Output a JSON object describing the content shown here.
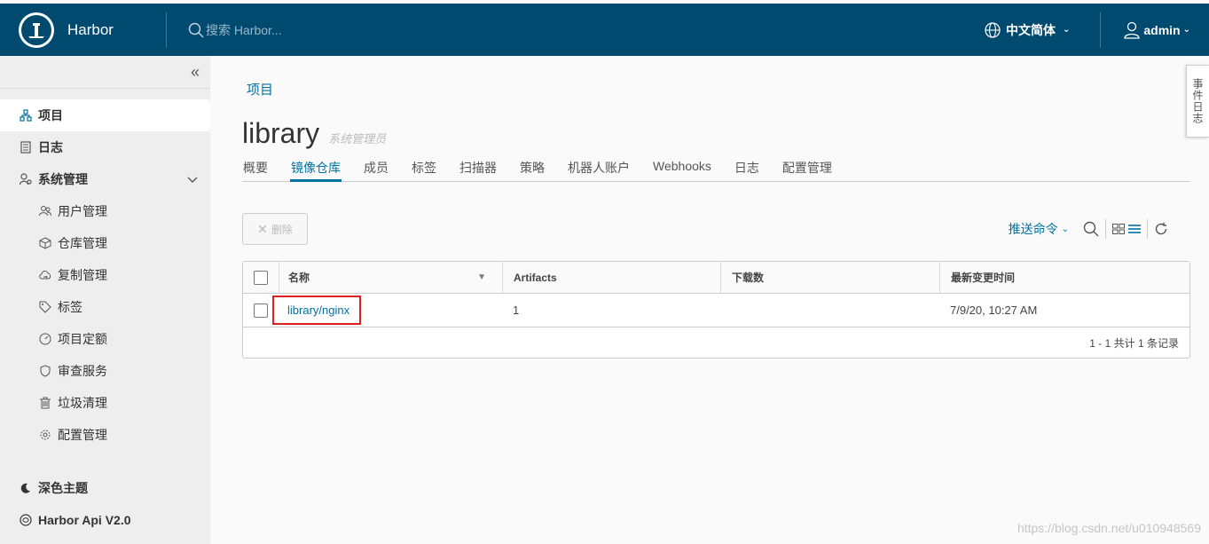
{
  "header": {
    "app_title": "Harbor",
    "search_placeholder": "搜索 Harbor...",
    "language": "中文简体",
    "user": "admin"
  },
  "sidebar": {
    "collapse_symbol": "«",
    "items": [
      {
        "label": "项目",
        "icon": "project-icon"
      },
      {
        "label": "日志",
        "icon": "log-icon"
      },
      {
        "label": "系统管理",
        "icon": "admin-icon"
      }
    ],
    "sub_items": [
      {
        "label": "用户管理",
        "icon": "users-icon"
      },
      {
        "label": "仓库管理",
        "icon": "registry-icon"
      },
      {
        "label": "复制管理",
        "icon": "replication-icon"
      },
      {
        "label": "标签",
        "icon": "tag-icon"
      },
      {
        "label": "项目定额",
        "icon": "quota-icon"
      },
      {
        "label": "审查服务",
        "icon": "shield-icon"
      },
      {
        "label": "垃圾清理",
        "icon": "trash-icon"
      },
      {
        "label": "配置管理",
        "icon": "gear-icon"
      }
    ],
    "footer": [
      {
        "label": "深色主题",
        "icon": "moon-icon"
      },
      {
        "label": "Harbor Api V2.0",
        "icon": "api-icon"
      }
    ]
  },
  "main": {
    "breadcrumb": "项目",
    "title": "library",
    "role": "系统管理员",
    "tabs": [
      {
        "label": "概要"
      },
      {
        "label": "镜像仓库"
      },
      {
        "label": "成员"
      },
      {
        "label": "标签"
      },
      {
        "label": "扫描器"
      },
      {
        "label": "策略"
      },
      {
        "label": "机器人账户"
      },
      {
        "label": "Webhooks"
      },
      {
        "label": "日志"
      },
      {
        "label": "配置管理"
      }
    ],
    "active_tab": "镜像仓库",
    "delete_label": "删除",
    "delete_symbol": "✕",
    "push_command": "推送命令",
    "table": {
      "columns": [
        "名称",
        "Artifacts",
        "下载数",
        "最新变更时间"
      ],
      "rows": [
        {
          "name": "library/nginx",
          "artifacts": "1",
          "downloads": "",
          "updated": "7/9/20, 10:27 AM"
        }
      ],
      "footer": "1 - 1 共计 1 条记录"
    }
  },
  "event_panel": "事件日志",
  "watermark": "https://blog.csdn.net/u010948569",
  "colors": {
    "header_bg": "#004a70",
    "accent": "#0072a3",
    "highlight_border": "#e02020"
  }
}
